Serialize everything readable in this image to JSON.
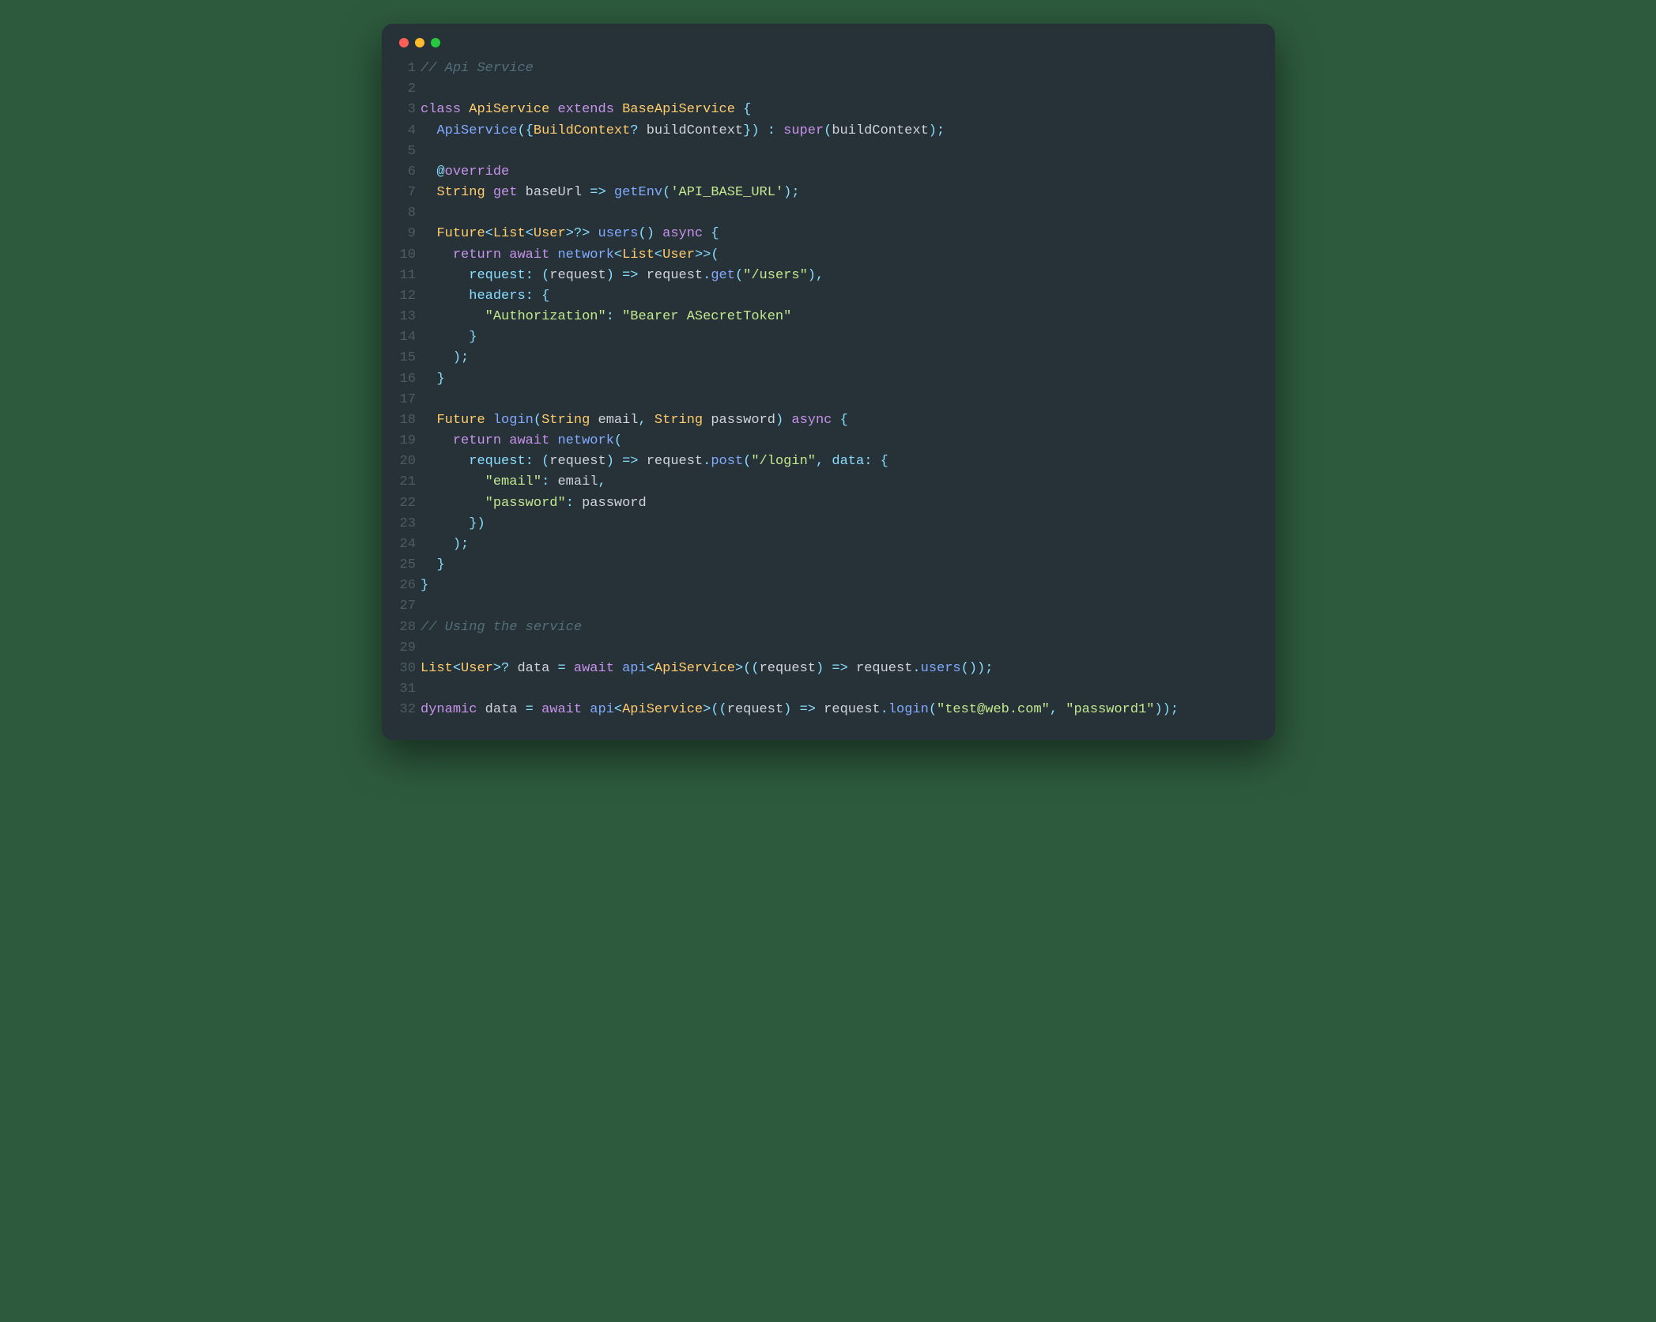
{
  "code": {
    "language": "dart",
    "lines": [
      {
        "n": 1,
        "tokens": [
          {
            "c": "cm",
            "t": "// Api Service"
          }
        ]
      },
      {
        "n": 2,
        "tokens": []
      },
      {
        "n": 3,
        "tokens": [
          {
            "c": "kw",
            "t": "class"
          },
          {
            "c": "id",
            "t": " "
          },
          {
            "c": "ty",
            "t": "ApiService"
          },
          {
            "c": "id",
            "t": " "
          },
          {
            "c": "kw",
            "t": "extends"
          },
          {
            "c": "id",
            "t": " "
          },
          {
            "c": "ty",
            "t": "BaseApiService"
          },
          {
            "c": "id",
            "t": " "
          },
          {
            "c": "pn",
            "t": "{"
          }
        ]
      },
      {
        "n": 4,
        "tokens": [
          {
            "c": "id",
            "t": "  "
          },
          {
            "c": "fn",
            "t": "ApiService"
          },
          {
            "c": "pn",
            "t": "({"
          },
          {
            "c": "ty",
            "t": "BuildContext"
          },
          {
            "c": "pn",
            "t": "?"
          },
          {
            "c": "id",
            "t": " buildContext"
          },
          {
            "c": "pn",
            "t": "})"
          },
          {
            "c": "id",
            "t": " "
          },
          {
            "c": "pn",
            "t": ":"
          },
          {
            "c": "id",
            "t": " "
          },
          {
            "c": "kw",
            "t": "super"
          },
          {
            "c": "pn",
            "t": "("
          },
          {
            "c": "id",
            "t": "buildContext"
          },
          {
            "c": "pn",
            "t": ");"
          }
        ]
      },
      {
        "n": 5,
        "tokens": []
      },
      {
        "n": 6,
        "tokens": [
          {
            "c": "id",
            "t": "  "
          },
          {
            "c": "at",
            "t": "@"
          },
          {
            "c": "nm",
            "t": "override"
          }
        ]
      },
      {
        "n": 7,
        "tokens": [
          {
            "c": "id",
            "t": "  "
          },
          {
            "c": "ty",
            "t": "String"
          },
          {
            "c": "id",
            "t": " "
          },
          {
            "c": "kw",
            "t": "get"
          },
          {
            "c": "id",
            "t": " baseUrl "
          },
          {
            "c": "pn",
            "t": "=>"
          },
          {
            "c": "id",
            "t": " "
          },
          {
            "c": "fn",
            "t": "getEnv"
          },
          {
            "c": "pn",
            "t": "("
          },
          {
            "c": "st",
            "t": "'API_BASE_URL'"
          },
          {
            "c": "pn",
            "t": ");"
          }
        ]
      },
      {
        "n": 8,
        "tokens": []
      },
      {
        "n": 9,
        "tokens": [
          {
            "c": "id",
            "t": "  "
          },
          {
            "c": "ty",
            "t": "Future"
          },
          {
            "c": "pn",
            "t": "<"
          },
          {
            "c": "ty",
            "t": "List"
          },
          {
            "c": "pn",
            "t": "<"
          },
          {
            "c": "ty",
            "t": "User"
          },
          {
            "c": "pn",
            "t": ">?>"
          },
          {
            "c": "id",
            "t": " "
          },
          {
            "c": "fn",
            "t": "users"
          },
          {
            "c": "pn",
            "t": "()"
          },
          {
            "c": "id",
            "t": " "
          },
          {
            "c": "kw",
            "t": "async"
          },
          {
            "c": "id",
            "t": " "
          },
          {
            "c": "pn",
            "t": "{"
          }
        ]
      },
      {
        "n": 10,
        "tokens": [
          {
            "c": "id",
            "t": "    "
          },
          {
            "c": "kw",
            "t": "return"
          },
          {
            "c": "id",
            "t": " "
          },
          {
            "c": "kw",
            "t": "await"
          },
          {
            "c": "id",
            "t": " "
          },
          {
            "c": "fn",
            "t": "network"
          },
          {
            "c": "pn",
            "t": "<"
          },
          {
            "c": "ty",
            "t": "List"
          },
          {
            "c": "pn",
            "t": "<"
          },
          {
            "c": "ty",
            "t": "User"
          },
          {
            "c": "pn",
            "t": ">>("
          }
        ]
      },
      {
        "n": 11,
        "tokens": [
          {
            "c": "id",
            "t": "      "
          },
          {
            "c": "named",
            "t": "request"
          },
          {
            "c": "pn",
            "t": ":"
          },
          {
            "c": "id",
            "t": " "
          },
          {
            "c": "pn",
            "t": "("
          },
          {
            "c": "id",
            "t": "request"
          },
          {
            "c": "pn",
            "t": ")"
          },
          {
            "c": "id",
            "t": " "
          },
          {
            "c": "pn",
            "t": "=>"
          },
          {
            "c": "id",
            "t": " request"
          },
          {
            "c": "pn",
            "t": "."
          },
          {
            "c": "fn",
            "t": "get"
          },
          {
            "c": "pn",
            "t": "("
          },
          {
            "c": "st",
            "t": "\"/users\""
          },
          {
            "c": "pn",
            "t": "),"
          }
        ]
      },
      {
        "n": 12,
        "tokens": [
          {
            "c": "id",
            "t": "      "
          },
          {
            "c": "named",
            "t": "headers"
          },
          {
            "c": "pn",
            "t": ":"
          },
          {
            "c": "id",
            "t": " "
          },
          {
            "c": "pn",
            "t": "{"
          }
        ]
      },
      {
        "n": 13,
        "tokens": [
          {
            "c": "id",
            "t": "        "
          },
          {
            "c": "st",
            "t": "\"Authorization\""
          },
          {
            "c": "pn",
            "t": ":"
          },
          {
            "c": "id",
            "t": " "
          },
          {
            "c": "st",
            "t": "\"Bearer ASecretToken\""
          }
        ]
      },
      {
        "n": 14,
        "tokens": [
          {
            "c": "id",
            "t": "      "
          },
          {
            "c": "pn",
            "t": "}"
          }
        ]
      },
      {
        "n": 15,
        "tokens": [
          {
            "c": "id",
            "t": "    "
          },
          {
            "c": "pn",
            "t": ");"
          }
        ]
      },
      {
        "n": 16,
        "tokens": [
          {
            "c": "id",
            "t": "  "
          },
          {
            "c": "pn",
            "t": "}"
          }
        ]
      },
      {
        "n": 17,
        "tokens": []
      },
      {
        "n": 18,
        "tokens": [
          {
            "c": "id",
            "t": "  "
          },
          {
            "c": "ty",
            "t": "Future"
          },
          {
            "c": "id",
            "t": " "
          },
          {
            "c": "fn",
            "t": "login"
          },
          {
            "c": "pn",
            "t": "("
          },
          {
            "c": "ty",
            "t": "String"
          },
          {
            "c": "id",
            "t": " email"
          },
          {
            "c": "pn",
            "t": ","
          },
          {
            "c": "id",
            "t": " "
          },
          {
            "c": "ty",
            "t": "String"
          },
          {
            "c": "id",
            "t": " password"
          },
          {
            "c": "pn",
            "t": ")"
          },
          {
            "c": "id",
            "t": " "
          },
          {
            "c": "kw",
            "t": "async"
          },
          {
            "c": "id",
            "t": " "
          },
          {
            "c": "pn",
            "t": "{"
          }
        ]
      },
      {
        "n": 19,
        "tokens": [
          {
            "c": "id",
            "t": "    "
          },
          {
            "c": "kw",
            "t": "return"
          },
          {
            "c": "id",
            "t": " "
          },
          {
            "c": "kw",
            "t": "await"
          },
          {
            "c": "id",
            "t": " "
          },
          {
            "c": "fn",
            "t": "network"
          },
          {
            "c": "pn",
            "t": "("
          }
        ]
      },
      {
        "n": 20,
        "tokens": [
          {
            "c": "id",
            "t": "      "
          },
          {
            "c": "named",
            "t": "request"
          },
          {
            "c": "pn",
            "t": ":"
          },
          {
            "c": "id",
            "t": " "
          },
          {
            "c": "pn",
            "t": "("
          },
          {
            "c": "id",
            "t": "request"
          },
          {
            "c": "pn",
            "t": ")"
          },
          {
            "c": "id",
            "t": " "
          },
          {
            "c": "pn",
            "t": "=>"
          },
          {
            "c": "id",
            "t": " request"
          },
          {
            "c": "pn",
            "t": "."
          },
          {
            "c": "fn",
            "t": "post"
          },
          {
            "c": "pn",
            "t": "("
          },
          {
            "c": "st",
            "t": "\"/login\""
          },
          {
            "c": "pn",
            "t": ","
          },
          {
            "c": "id",
            "t": " "
          },
          {
            "c": "named",
            "t": "data"
          },
          {
            "c": "pn",
            "t": ":"
          },
          {
            "c": "id",
            "t": " "
          },
          {
            "c": "pn",
            "t": "{"
          }
        ]
      },
      {
        "n": 21,
        "tokens": [
          {
            "c": "id",
            "t": "        "
          },
          {
            "c": "st",
            "t": "\"email\""
          },
          {
            "c": "pn",
            "t": ":"
          },
          {
            "c": "id",
            "t": " email"
          },
          {
            "c": "pn",
            "t": ","
          }
        ]
      },
      {
        "n": 22,
        "tokens": [
          {
            "c": "id",
            "t": "        "
          },
          {
            "c": "st",
            "t": "\"password\""
          },
          {
            "c": "pn",
            "t": ":"
          },
          {
            "c": "id",
            "t": " password"
          }
        ]
      },
      {
        "n": 23,
        "tokens": [
          {
            "c": "id",
            "t": "      "
          },
          {
            "c": "pn",
            "t": "})"
          }
        ]
      },
      {
        "n": 24,
        "tokens": [
          {
            "c": "id",
            "t": "    "
          },
          {
            "c": "pn",
            "t": ");"
          }
        ]
      },
      {
        "n": 25,
        "tokens": [
          {
            "c": "id",
            "t": "  "
          },
          {
            "c": "pn",
            "t": "}"
          }
        ]
      },
      {
        "n": 26,
        "tokens": [
          {
            "c": "pn",
            "t": "}"
          }
        ]
      },
      {
        "n": 27,
        "tokens": []
      },
      {
        "n": 28,
        "tokens": [
          {
            "c": "cm",
            "t": "// Using the service"
          }
        ]
      },
      {
        "n": 29,
        "tokens": []
      },
      {
        "n": 30,
        "tokens": [
          {
            "c": "ty",
            "t": "List"
          },
          {
            "c": "pn",
            "t": "<"
          },
          {
            "c": "ty",
            "t": "User"
          },
          {
            "c": "pn",
            "t": ">?"
          },
          {
            "c": "id",
            "t": " data "
          },
          {
            "c": "pn",
            "t": "="
          },
          {
            "c": "id",
            "t": " "
          },
          {
            "c": "kw",
            "t": "await"
          },
          {
            "c": "id",
            "t": " "
          },
          {
            "c": "fn",
            "t": "api"
          },
          {
            "c": "pn",
            "t": "<"
          },
          {
            "c": "ty",
            "t": "ApiService"
          },
          {
            "c": "pn",
            "t": ">(("
          },
          {
            "c": "id",
            "t": "request"
          },
          {
            "c": "pn",
            "t": ")"
          },
          {
            "c": "id",
            "t": " "
          },
          {
            "c": "pn",
            "t": "=>"
          },
          {
            "c": "id",
            "t": " request"
          },
          {
            "c": "pn",
            "t": "."
          },
          {
            "c": "fn",
            "t": "users"
          },
          {
            "c": "pn",
            "t": "());"
          }
        ]
      },
      {
        "n": 31,
        "tokens": []
      },
      {
        "n": 32,
        "tokens": [
          {
            "c": "kw",
            "t": "dynamic"
          },
          {
            "c": "id",
            "t": " data "
          },
          {
            "c": "pn",
            "t": "="
          },
          {
            "c": "id",
            "t": " "
          },
          {
            "c": "kw",
            "t": "await"
          },
          {
            "c": "id",
            "t": " "
          },
          {
            "c": "fn",
            "t": "api"
          },
          {
            "c": "pn",
            "t": "<"
          },
          {
            "c": "ty",
            "t": "ApiService"
          },
          {
            "c": "pn",
            "t": ">(("
          },
          {
            "c": "id",
            "t": "request"
          },
          {
            "c": "pn",
            "t": ")"
          },
          {
            "c": "id",
            "t": " "
          },
          {
            "c": "pn",
            "t": "=>"
          },
          {
            "c": "id",
            "t": " request"
          },
          {
            "c": "pn",
            "t": "."
          },
          {
            "c": "fn",
            "t": "login"
          },
          {
            "c": "pn",
            "t": "("
          },
          {
            "c": "st",
            "t": "\"test@web.com\""
          },
          {
            "c": "pn",
            "t": ","
          },
          {
            "c": "id",
            "t": " "
          },
          {
            "c": "st",
            "t": "\"password1\""
          },
          {
            "c": "pn",
            "t": "));"
          }
        ]
      }
    ]
  }
}
